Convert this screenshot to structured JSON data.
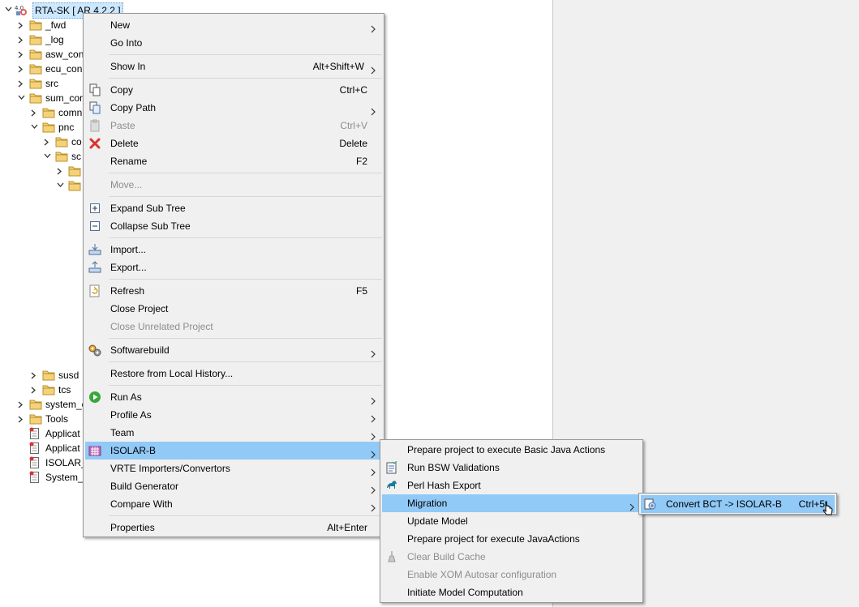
{
  "tree": {
    "root": {
      "label": "RTA-SK [ AR 4.2.2 ]",
      "badge": "4.0"
    },
    "items": [
      {
        "label": "_fwd"
      },
      {
        "label": "_log"
      },
      {
        "label": "asw_con"
      },
      {
        "label": "ecu_con"
      },
      {
        "label": "src"
      },
      {
        "label": "sum_con"
      },
      {
        "label": "comn"
      },
      {
        "label": "pnc"
      },
      {
        "label": "co"
      },
      {
        "label": "sc"
      },
      {
        "label": ""
      },
      {
        "label": ""
      },
      {
        "label": "susd"
      },
      {
        "label": "tcs"
      },
      {
        "label": "system_c"
      },
      {
        "label": "Tools"
      },
      {
        "label": "Applicat"
      },
      {
        "label": "Applicat"
      },
      {
        "label": "ISOLAR_"
      },
      {
        "label": "System_l"
      }
    ]
  },
  "context_menu": {
    "items": [
      {
        "label": "New",
        "accel": ""
      },
      {
        "label": "Go Into",
        "accel": ""
      },
      {
        "label": "Show In",
        "accel": "Alt+Shift+W"
      },
      {
        "label": "Copy",
        "accel": "Ctrl+C"
      },
      {
        "label": "Copy Path",
        "accel": ""
      },
      {
        "label": "Paste",
        "accel": "Ctrl+V"
      },
      {
        "label": "Delete",
        "accel": "Delete"
      },
      {
        "label": "Rename",
        "accel": "F2"
      },
      {
        "label": "Move...",
        "accel": ""
      },
      {
        "label": "Expand Sub Tree",
        "accel": ""
      },
      {
        "label": "Collapse Sub Tree",
        "accel": ""
      },
      {
        "label": "Import...",
        "accel": ""
      },
      {
        "label": "Export...",
        "accel": ""
      },
      {
        "label": "Refresh",
        "accel": "F5"
      },
      {
        "label": "Close Project",
        "accel": ""
      },
      {
        "label": "Close Unrelated Project",
        "accel": ""
      },
      {
        "label": "Softwarebuild",
        "accel": ""
      },
      {
        "label": "Restore from Local History...",
        "accel": ""
      },
      {
        "label": "Run As",
        "accel": ""
      },
      {
        "label": "Profile As",
        "accel": ""
      },
      {
        "label": "Team",
        "accel": ""
      },
      {
        "label": "ISOLAR-B",
        "accel": ""
      },
      {
        "label": "VRTE Importers/Convertors",
        "accel": ""
      },
      {
        "label": "Build Generator",
        "accel": ""
      },
      {
        "label": "Compare With",
        "accel": ""
      },
      {
        "label": "Properties",
        "accel": "Alt+Enter"
      }
    ]
  },
  "isolar_submenu": {
    "items": [
      {
        "label": "Prepare project to execute Basic Java Actions"
      },
      {
        "label": "Run BSW Validations"
      },
      {
        "label": "Perl Hash Export"
      },
      {
        "label": "Migration"
      },
      {
        "label": "Update Model"
      },
      {
        "label": "Prepare project for execute JavaActions"
      },
      {
        "label": "Clear Build Cache"
      },
      {
        "label": "Enable XOM Autosar configuration"
      },
      {
        "label": "Initiate Model Computation"
      }
    ]
  },
  "migration_submenu": {
    "items": [
      {
        "label": "Convert BCT -> ISOLAR-B",
        "accel": "Ctrl+5"
      }
    ]
  },
  "colors": {
    "highlight": "#91c9f7",
    "menu_bg": "#f0f0f0",
    "disabled_text": "#8d8d8d",
    "tree_selection": "#cce8ff"
  }
}
